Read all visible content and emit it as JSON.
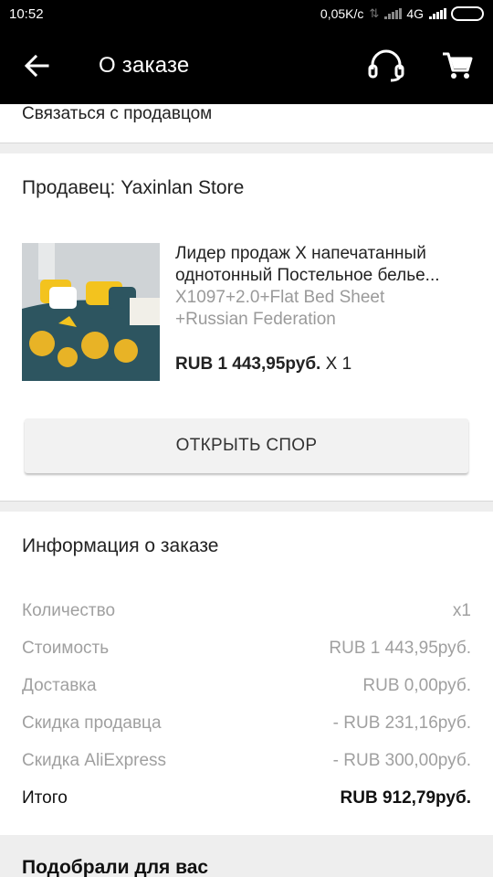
{
  "status": {
    "time": "10:52",
    "network_speed": "0,05K/c",
    "network_type": "4G"
  },
  "header": {
    "title": "О заказе",
    "back_icon": "arrow-left-icon",
    "support_icon": "headset-icon",
    "cart_icon": "cart-icon"
  },
  "contact_seller": "Связаться с продавцом",
  "seller": {
    "label": "Продавец: Yaxinlan Store"
  },
  "product": {
    "name_line1": "Лидер продаж X напечатанный",
    "name_line2": "однотонный Постельное белье...",
    "variant_line1": "X1097+2.0+Flat Bed Sheet",
    "variant_line2": "+Russian Federation",
    "price": "RUB 1 443,95руб.",
    "quantity": " X 1"
  },
  "dispute_button": "ОТКРЫТЬ СПОР",
  "order_info": {
    "title": "Информация о заказе",
    "rows": [
      {
        "label": "Количество",
        "value": "x1"
      },
      {
        "label": "Стоимость",
        "value": "RUB 1 443,95руб."
      },
      {
        "label": "Доставка",
        "value": "RUB 0,00руб."
      },
      {
        "label": "Скидка продавца",
        "value": "- RUB 231,16руб."
      },
      {
        "label": "Скидка AliExpress",
        "value": "- RUB 300,00руб."
      },
      {
        "label": "Итого",
        "value": "RUB 912,79руб."
      }
    ]
  },
  "recommend_title": "Подобрали для вас",
  "colors": {
    "bar_background": "#000000",
    "separator": "#eeeeee",
    "muted_text": "#a0a0a0"
  }
}
